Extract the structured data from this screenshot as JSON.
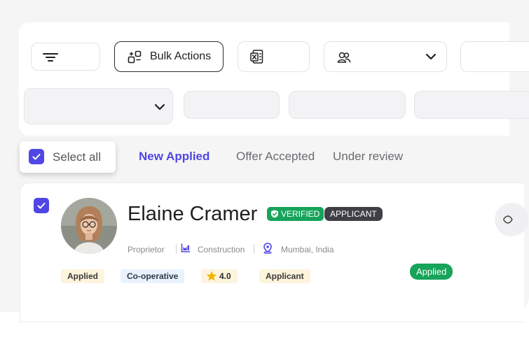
{
  "toolbar": {
    "bulk_actions_label": "Bulk Actions"
  },
  "selection": {
    "select_all_label": "Select all"
  },
  "tabs": [
    {
      "label": "New Applied",
      "active": true
    },
    {
      "label": "Offer Accepted",
      "active": false
    },
    {
      "label": "Under review",
      "active": false
    }
  ],
  "candidate": {
    "name": "Elaine Cramer",
    "verified_label": "VERIFIED",
    "role_badge": "APPLICANT",
    "occupation": "Proprietor",
    "industry": "Construction",
    "location": "Mumbai, India",
    "tags": [
      "Applied",
      "Co-operative",
      "4.0",
      "Applicant"
    ],
    "status": "Applied"
  },
  "colors": {
    "accent": "#4f46e5",
    "success": "#16a35a",
    "dark_badge": "#3f3f46",
    "tag_yellow": "#fdf4dd",
    "tag_blue": "#eaf3fc",
    "star": "#f4b400"
  }
}
